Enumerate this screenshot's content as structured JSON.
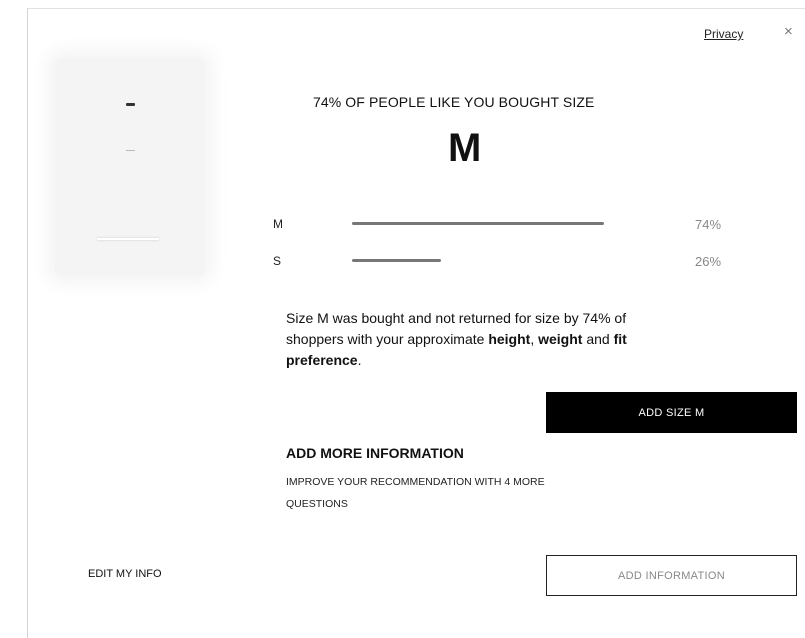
{
  "header": {
    "privacy_link": "Privacy",
    "close_glyph": "×"
  },
  "recommendation": {
    "headline": "74% OF PEOPLE LIKE YOU BOUGHT SIZE",
    "size": "M",
    "distribution": [
      {
        "size": "M",
        "percent_label": "74%",
        "value": 74
      },
      {
        "size": "S",
        "percent_label": "26%",
        "value": 26
      }
    ],
    "explanation": {
      "part1": "Size M was bought and not returned for size by 74% of shoppers with your approximate ",
      "height": "height",
      "sep1": ", ",
      "weight": "weight",
      "sep2": " and ",
      "fit_preference": "fit preference",
      "end": "."
    },
    "add_button": "ADD SIZE M"
  },
  "more_info": {
    "title": "ADD MORE INFORMATION",
    "subtitle": "IMPROVE YOUR RECOMMENDATION WITH 4 MORE QUESTIONS",
    "button": "ADD INFORMATION"
  },
  "footer": {
    "edit_info": "EDIT MY INFO"
  },
  "colors": {
    "primary": "#000000",
    "bar": "#777777",
    "muted_text": "#888888"
  }
}
